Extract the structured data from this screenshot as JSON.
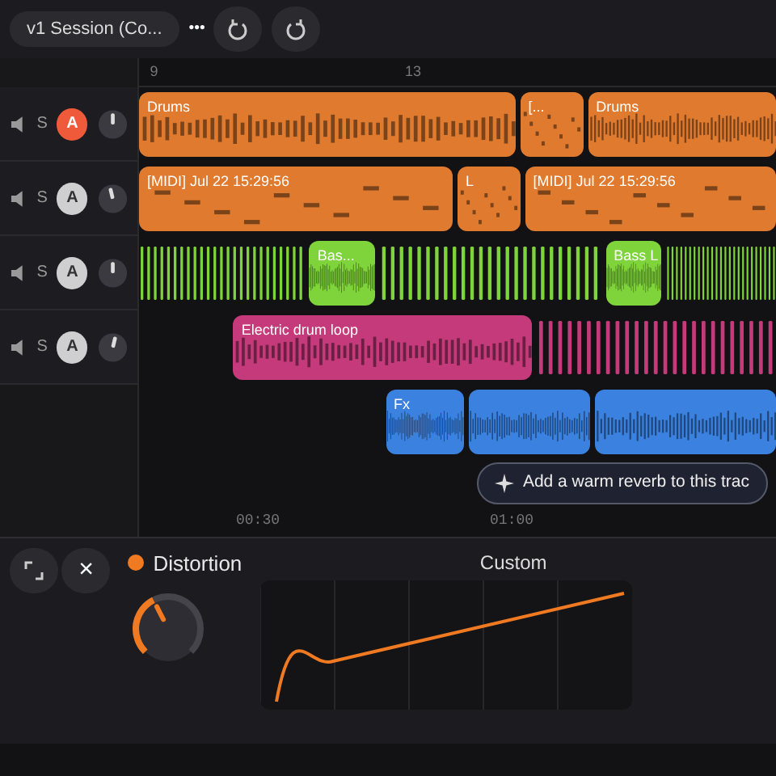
{
  "toolbar": {
    "session_title": "v1 Session (Co...",
    "more_button": "•••"
  },
  "ruler": {
    "marks": [
      "9",
      "13"
    ]
  },
  "track_headers": [
    {
      "solo_label": "S",
      "arm_label": "A",
      "armed": true,
      "level": 0.5
    },
    {
      "solo_label": "S",
      "arm_label": "A",
      "armed": false,
      "level": 0.45
    },
    {
      "solo_label": "S",
      "arm_label": "A",
      "armed": false,
      "level": 0.5
    },
    {
      "solo_label": "S",
      "arm_label": "A",
      "armed": false,
      "level": 0.55
    }
  ],
  "tracks": [
    {
      "color": "#e07a2e",
      "clips": [
        {
          "kind": "audio",
          "label": "Drums"
        },
        {
          "kind": "midi",
          "label": "[..."
        },
        {
          "kind": "audio",
          "label": "Drums"
        }
      ]
    },
    {
      "color": "#e07a2e",
      "clips": [
        {
          "kind": "midi",
          "label": "[MIDI] Jul 22 15:29:56"
        },
        {
          "kind": "midi",
          "label": "L"
        },
        {
          "kind": "midi",
          "label": "[MIDI] Jul 22 15:29:56"
        }
      ]
    },
    {
      "color": "#7ed43a",
      "clips": [
        {
          "kind": "pulse"
        },
        {
          "kind": "audio",
          "label": "Bas..."
        },
        {
          "kind": "pulse"
        },
        {
          "kind": "audio",
          "label": "Bass L"
        },
        {
          "kind": "pulse"
        }
      ]
    },
    {
      "color": "#c43a7a",
      "clips": [
        {
          "kind": "gap"
        },
        {
          "kind": "audio",
          "label": "Electric drum loop"
        },
        {
          "kind": "pulse"
        }
      ]
    },
    {
      "color": "#3b82e0",
      "clips": [
        {
          "kind": "gap"
        },
        {
          "kind": "audio",
          "label": "Fx"
        },
        {
          "kind": "audio"
        },
        {
          "kind": "audio"
        }
      ]
    }
  ],
  "time_ruler": {
    "marks": [
      "00:30",
      "01:00"
    ]
  },
  "assistant_prompt": {
    "text": "Add a warm reverb to this trac"
  },
  "effect_panel": {
    "name": "Distortion",
    "enabled": true,
    "level": 0.4,
    "preset": "Custom",
    "close_button": "×"
  }
}
